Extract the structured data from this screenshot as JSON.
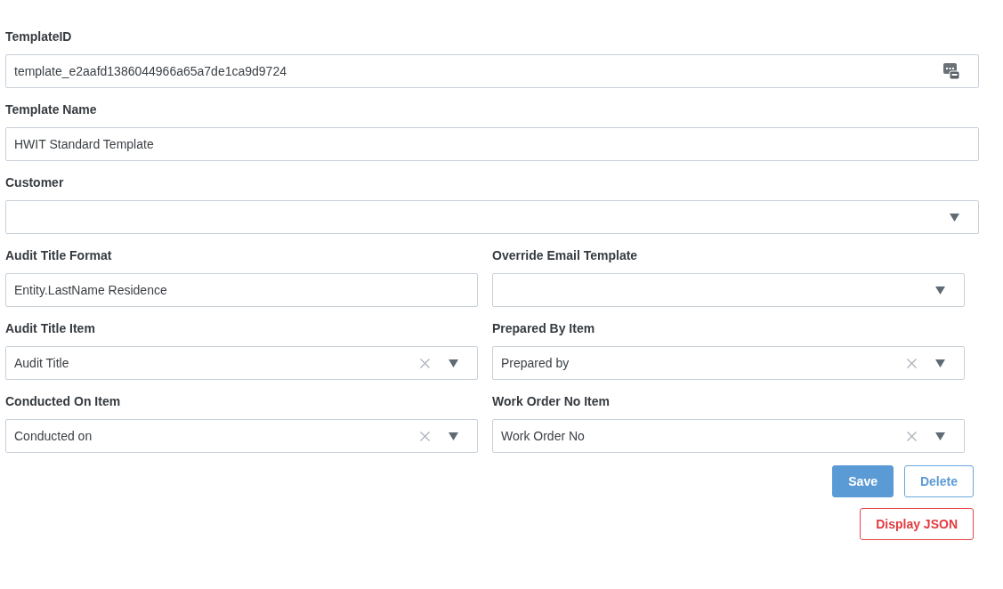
{
  "form": {
    "rows": [
      {
        "fields": [
          {
            "label": "TemplateID",
            "kind": "id",
            "value": "template_e2aafd1386044966a65a7de1ca9d9724"
          }
        ]
      },
      {
        "fields": [
          {
            "label": "Template Name",
            "kind": "text",
            "value": "HWIT Standard Template"
          }
        ]
      },
      {
        "fields": [
          {
            "label": "Customer",
            "kind": "select"
          }
        ]
      },
      {
        "fields": [
          {
            "label": "Audit Title Format",
            "kind": "text",
            "value": "Entity.LastName Residence"
          },
          {
            "label": "Override Email Template",
            "kind": "select"
          }
        ]
      },
      {
        "fields": [
          {
            "label": "Audit Title Item",
            "kind": "select",
            "value": "Audit Title"
          },
          {
            "label": "Prepared By Item",
            "kind": "select",
            "value": "Prepared by"
          }
        ]
      },
      {
        "fields": [
          {
            "label": "Conducted On Item",
            "kind": "select",
            "value": "Conducted on"
          },
          {
            "label": "Work Order No Item",
            "kind": "select",
            "value": "Work Order No"
          }
        ]
      }
    ]
  },
  "actions": [
    {
      "buttons": [
        {
          "label": "Save",
          "kind": "primary"
        },
        {
          "label": "Delete",
          "kind": "outline"
        }
      ]
    },
    {
      "buttons": [
        {
          "label": "Display JSON",
          "kind": "danger"
        }
      ]
    }
  ]
}
